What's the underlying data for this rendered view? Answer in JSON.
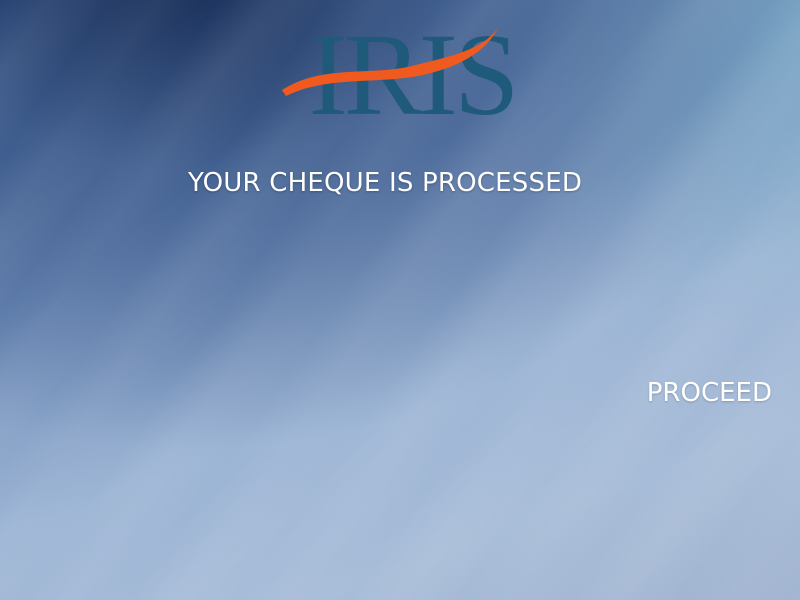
{
  "app": {
    "logo_text": "IRIS",
    "logo_colors": {
      "letters": "#1f5a7a",
      "swoosh": "#f05a1e"
    }
  },
  "message": {
    "title": "YOUR CHEQUE IS PROCESSED"
  },
  "actions": {
    "proceed_label": "PROCEED"
  }
}
